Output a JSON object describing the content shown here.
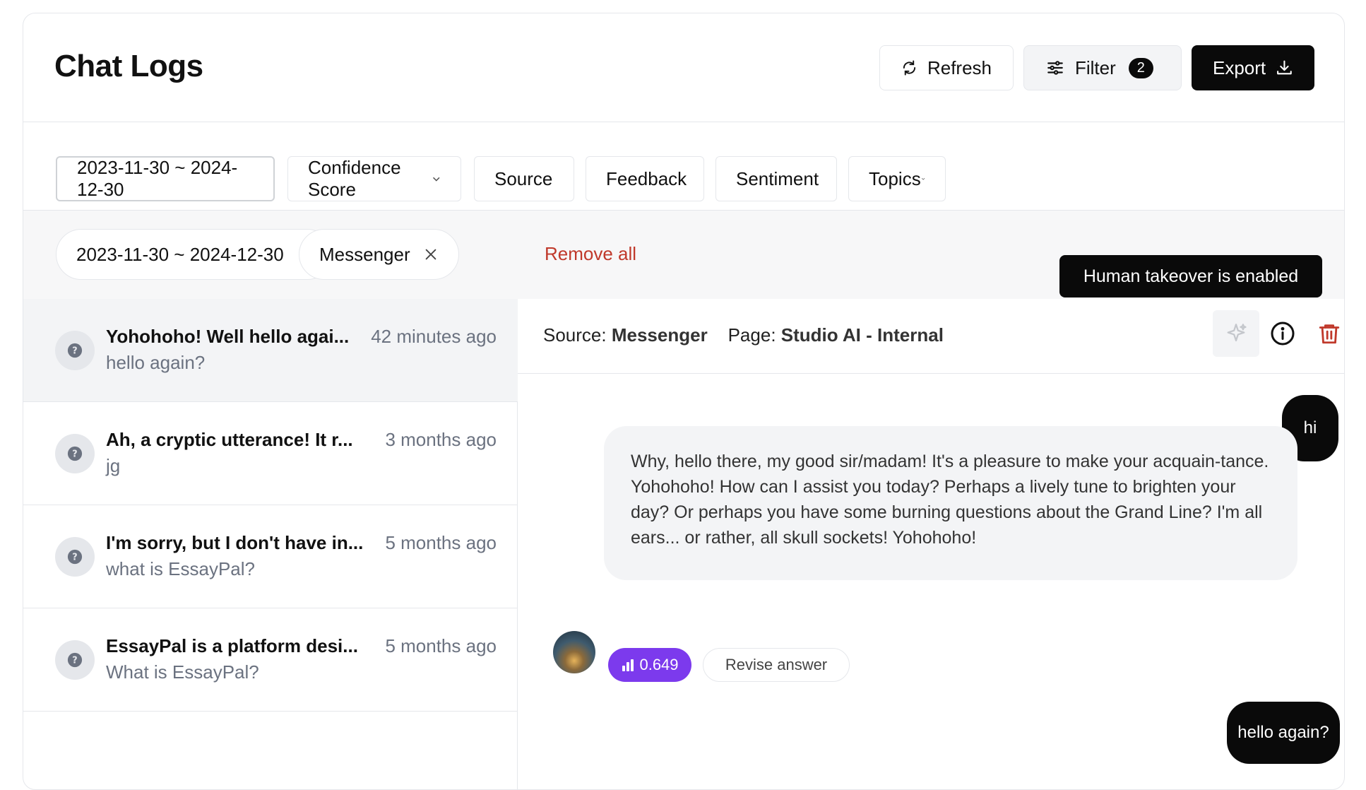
{
  "header": {
    "title": "Chat Logs",
    "refresh_label": "Refresh",
    "filter_label": "Filter",
    "filter_count": "2",
    "export_label": "Export"
  },
  "filters": {
    "date_range": "2023-11-30 ~ 2024-12-30",
    "dropdowns": [
      "Confidence Score",
      "Source",
      "Feedback",
      "Sentiment",
      "Topics"
    ]
  },
  "chips": {
    "items": [
      "2023-11-30 ~ 2024-12-30",
      "Messenger"
    ],
    "remove_all": "Remove all"
  },
  "tooltip": "Human takeover is enabled",
  "logs": [
    {
      "title": "Yohohoho! Well hello agai...",
      "time": "42 minutes ago",
      "preview": "hello again?"
    },
    {
      "title": "Ah, a cryptic utterance! It r...",
      "time": "3 months ago",
      "preview": "jg"
    },
    {
      "title": "I'm sorry, but I don't have in...",
      "time": "5 months ago",
      "preview": "what is EssayPal?"
    },
    {
      "title": "EssayPal is a platform desi...",
      "time": "5 months ago",
      "preview": "What is EssayPal?"
    }
  ],
  "detail": {
    "source_label": "Source:",
    "source_value": "Messenger",
    "page_label": "Page:",
    "page_value": "Studio AI - Internal",
    "messages": {
      "user_1": "hi",
      "bot_1": "Why, hello there, my good sir/madam! It's a pleasure to make your acquain-tance. Yohohoho! How can I assist you today? Perhaps a lively tune to brighten your day? Or perhaps you have some burning questions about the Grand Line? I'm all ears... or rather, all skull sockets! Yohohoho!",
      "score": "0.649",
      "revise_label": "Revise answer",
      "user_2": "hello again?"
    }
  },
  "colors": {
    "accent": "#7c3aed",
    "danger": "#c0392b",
    "dark": "#0a0a0a"
  }
}
